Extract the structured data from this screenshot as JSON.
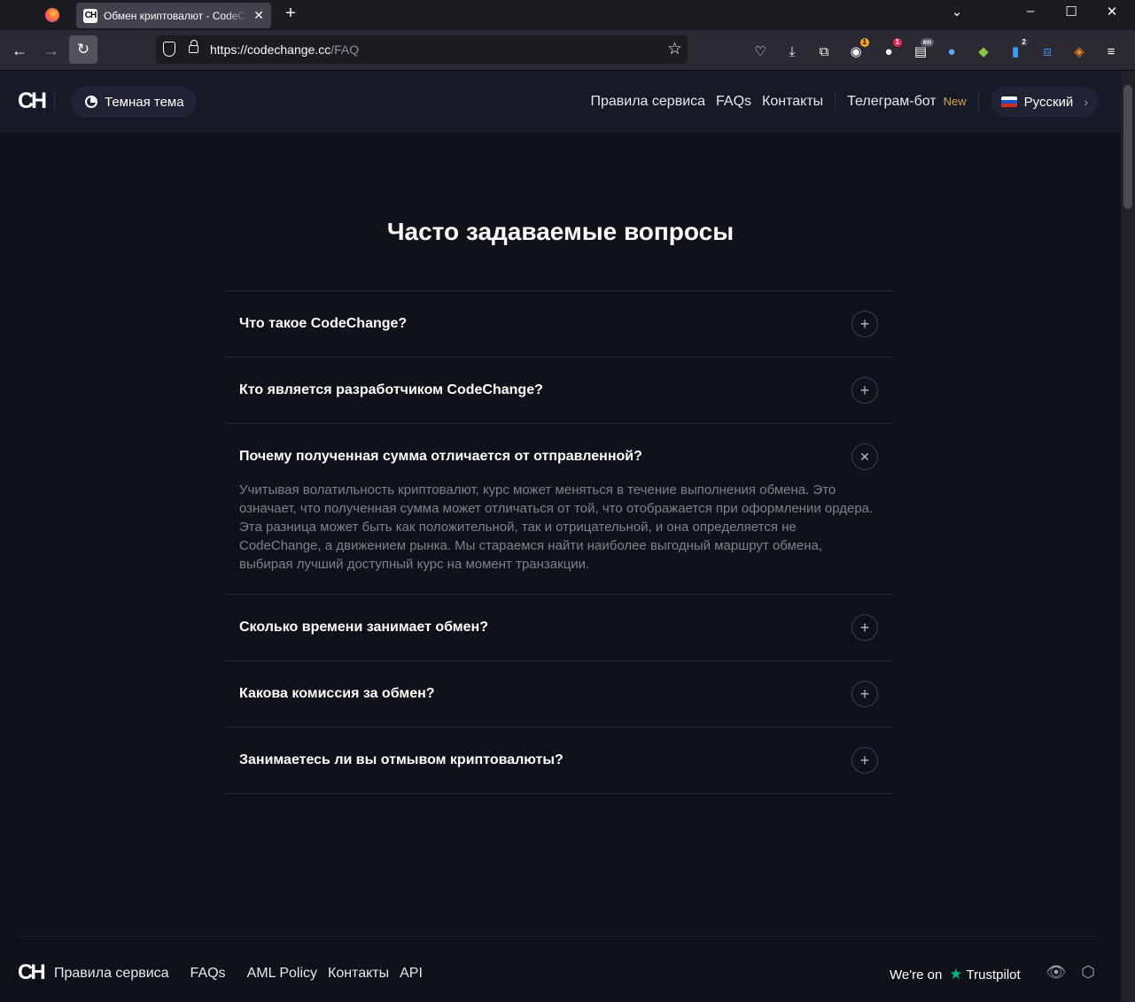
{
  "browser": {
    "tab_title": "Обмен криптовалют - CodeChange",
    "url_host": "https://codechange.cc",
    "url_path": "/FAQ",
    "extensions": [
      {
        "name": "ext-1-icon",
        "badge": "1",
        "badge_color": "#f5a623"
      },
      {
        "name": "ext-2-icon",
        "badge": "1",
        "badge_color": "#e22850"
      },
      {
        "name": "ext-3-icon",
        "badge": "en",
        "badge_color": "#5b5b66"
      },
      {
        "name": "ext-4-icon",
        "badge": ""
      },
      {
        "name": "ext-5-icon",
        "badge": ""
      },
      {
        "name": "ext-6-icon",
        "badge": "2",
        "badge_color": "#3b3b45"
      },
      {
        "name": "ext-7-icon",
        "badge": ""
      },
      {
        "name": "ext-8-icon",
        "badge": ""
      }
    ]
  },
  "header": {
    "logo": "CH",
    "theme_label": "Темная тема",
    "nav": {
      "rules": "Правила сервиса",
      "faqs": "FAQs",
      "contacts": "Контакты",
      "telegram": "Телеграм-бот",
      "new_badge": "New",
      "language": "Русский"
    }
  },
  "main": {
    "title": "Часто задаваемые вопросы",
    "faq": [
      {
        "question": "Что такое CodeChange?",
        "open": false
      },
      {
        "question": "Кто является разработчиком CodeChange?",
        "open": false
      },
      {
        "question": "Почему полученная сумма отличается от отправленной?",
        "open": true,
        "answer": "Учитывая волатильность криптовалют, курс может меняться в течение выполнения обмена. Это означает, что полученная сумма может отличаться от той, что отображается при оформлении ордера. Эта разница может быть как положительной, так и отрицательной, и она определяется не CodeChange, а движением рынка. Мы стараемся найти наиболее выгодный маршрут обмена, выбирая лучший доступный курс на момент транзакции."
      },
      {
        "question": "Сколько времени занимает обмен?",
        "open": false
      },
      {
        "question": "Какова комиссия за обмен?",
        "open": false
      },
      {
        "question": "Занимаетесь ли вы отмывом криптовалюты?",
        "open": false
      }
    ]
  },
  "footer": {
    "logo": "CH",
    "links": {
      "rules": "Правила сервиса",
      "faqs": "FAQs",
      "aml": "AML Policy",
      "contacts": "Контакты",
      "api": "API"
    },
    "trust_prefix": "We're on",
    "trust_name": "Trustpilot"
  },
  "colors": {
    "background": "#0f111b",
    "header": "#161927",
    "accent_new": "#d9a545",
    "trustpilot": "#00b67a"
  }
}
